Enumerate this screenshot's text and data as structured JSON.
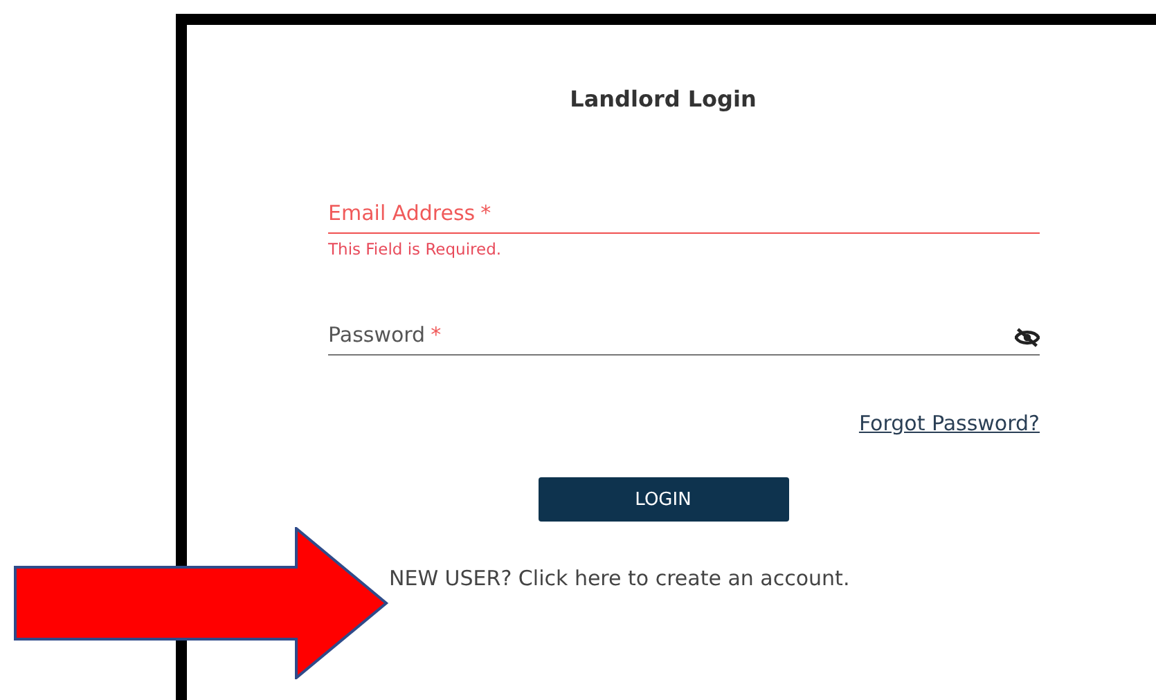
{
  "title": "Landlord Login",
  "fields": [
    {
      "kind": "email",
      "label": "Email Address",
      "required_mark": "*",
      "invalid": true,
      "error": "This Field is Required."
    },
    {
      "kind": "password",
      "label": "Password",
      "required_mark": "*",
      "invalid": false
    }
  ],
  "forgot_link": "Forgot Password?",
  "login_button": "LOGIN",
  "new_user": "NEW USER? Click here to create an account.",
  "annotation": {
    "kind": "arrow"
  }
}
